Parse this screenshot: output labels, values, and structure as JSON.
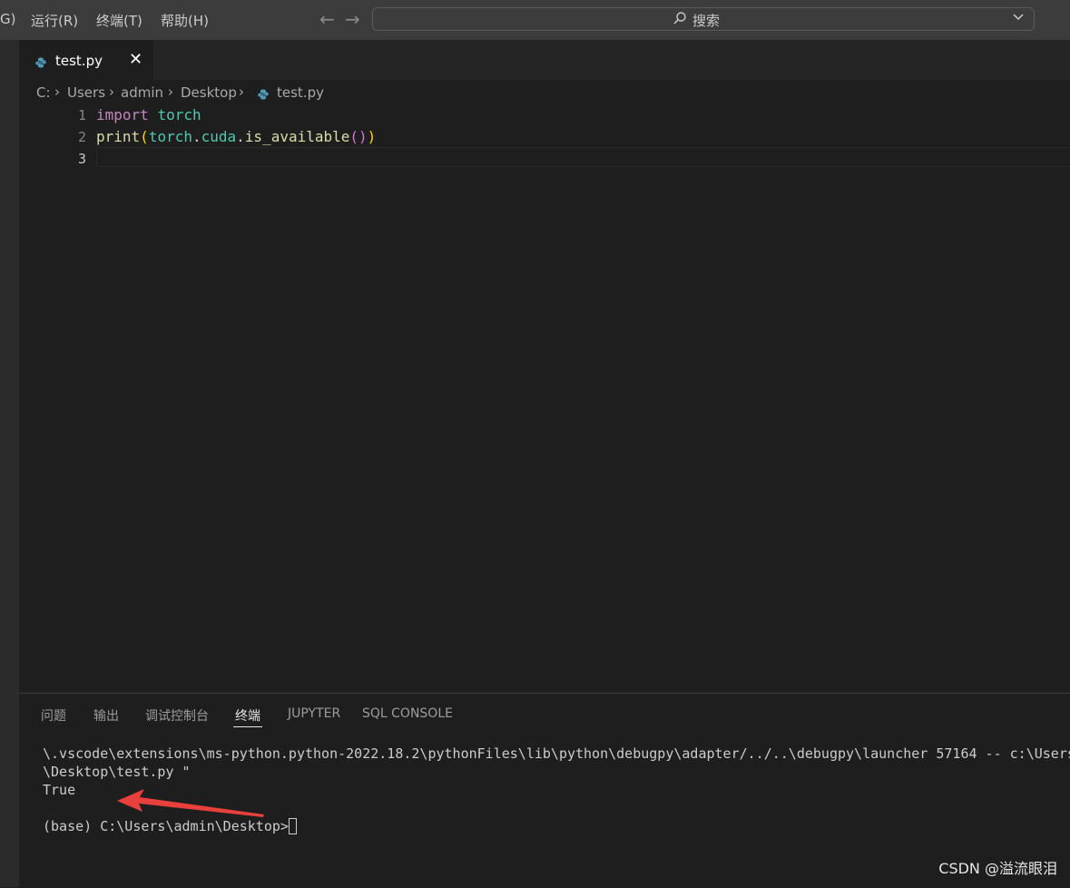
{
  "menu": {
    "partial": "G)",
    "run": "运行(R)",
    "terminal": "终端(T)",
    "help": "帮助(H)"
  },
  "search": {
    "label": "搜索",
    "icon": "search-icon"
  },
  "tab": {
    "label": "test.py",
    "close": "✕"
  },
  "breadcrumb": [
    "C:",
    "Users",
    "admin",
    "Desktop",
    "test.py"
  ],
  "editor": {
    "line_numbers": [
      "1",
      "2",
      "3"
    ],
    "line1": {
      "kw": "import",
      "mod": "torch"
    },
    "line2": {
      "fn": "print",
      "open1": "(",
      "mod": "torch",
      "dot1": ".",
      "attr": "cuda",
      "dot2": ".",
      "call": "is_available",
      "open2": "(",
      "close2": ")",
      "close1": ")"
    }
  },
  "panel": {
    "tabs": [
      "问题",
      "输出",
      "调试控制台",
      "终端",
      "JUPYTER",
      "SQL CONSOLE"
    ],
    "active_tab": "终端",
    "terminal_lines": [
      "\\.vscode\\extensions\\ms-python.python-2022.18.2\\pythonFiles\\lib\\python\\debugpy\\adapter/../..\\debugpy\\launcher 57164 -- c:\\Users",
      "\\Desktop\\test.py \"",
      "True",
      "",
      "(base) C:\\Users\\admin\\Desktop>"
    ]
  },
  "watermark": "CSDN @溢流眼泪",
  "colors": {
    "accent_arrow": "#e8403a",
    "keyword": "#c586c0",
    "module": "#4ec9b0",
    "function": "#dcdcaa"
  }
}
